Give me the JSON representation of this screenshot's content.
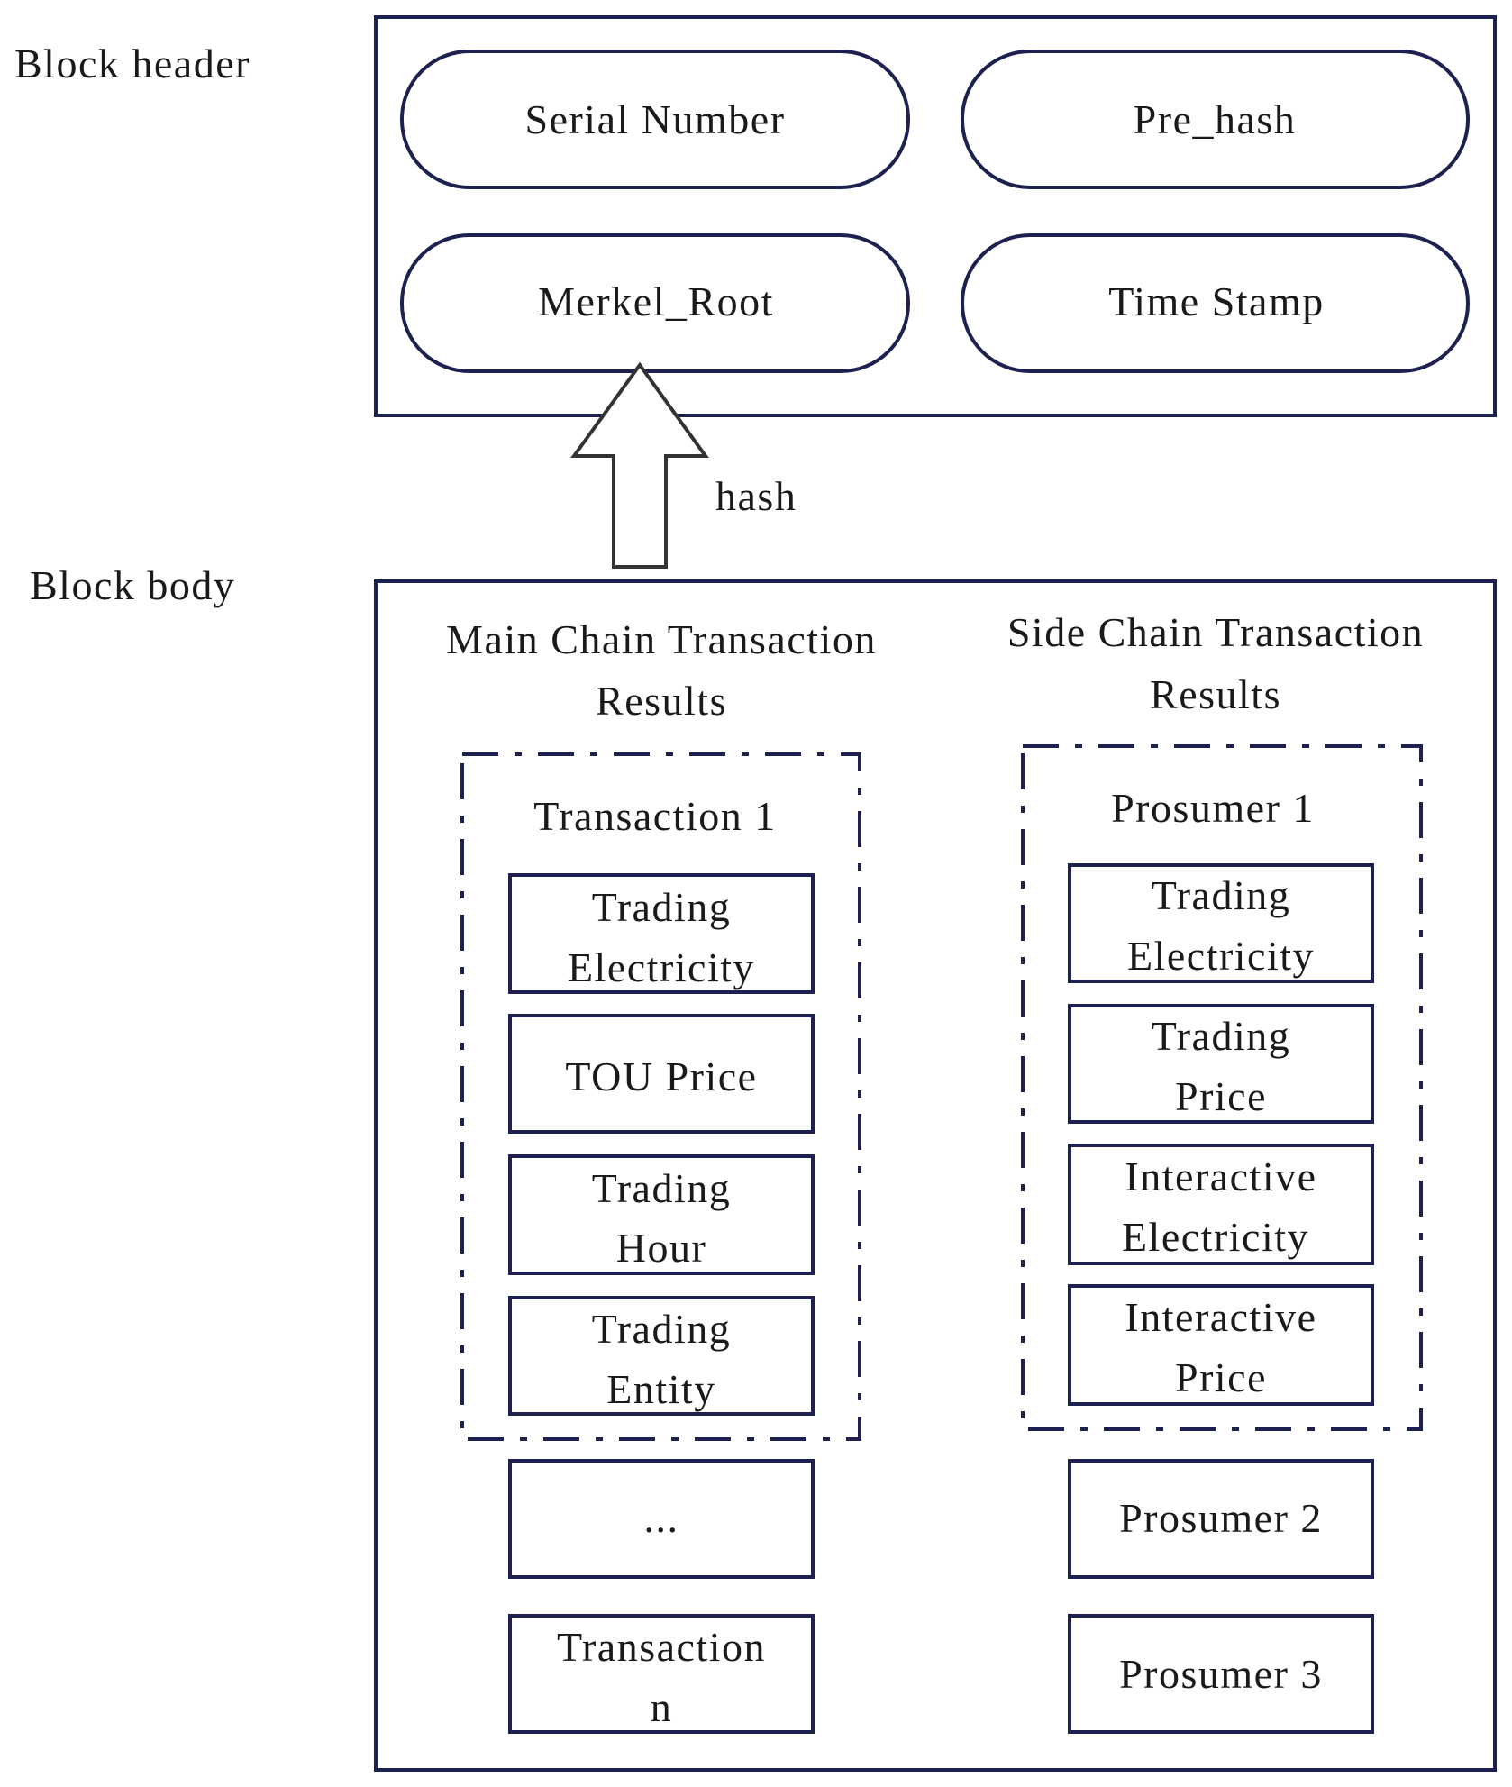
{
  "labels": {
    "block_header": "Block header",
    "block_body": "Block body",
    "hash": "hash"
  },
  "header_fields": {
    "serial_number": "Serial Number",
    "pre_hash": "Pre_hash",
    "merkel_root": "Merkel_Root",
    "time_stamp": "Time Stamp"
  },
  "main_chain": {
    "title_line1": "Main Chain Transaction",
    "title_line2": "Results",
    "group_title": "Transaction 1",
    "fields": [
      {
        "line1": "Trading",
        "line2": "Electricity"
      },
      {
        "line1": "TOU Price"
      },
      {
        "line1": "Trading",
        "line2": "Hour"
      },
      {
        "line1": "Trading",
        "line2": "Entity"
      }
    ],
    "ellipsis": "...",
    "last": {
      "line1": "Transaction",
      "line2": "n"
    }
  },
  "side_chain": {
    "title_line1": "Side Chain Transaction",
    "title_line2": "Results",
    "group_title": "Prosumer 1",
    "fields": [
      {
        "line1": "Trading",
        "line2": "Electricity"
      },
      {
        "line1": "Trading",
        "line2": "Price"
      },
      {
        "line1": "Interactive",
        "line2": "Electricity"
      },
      {
        "line1": "Interactive",
        "line2": "Price"
      }
    ],
    "others": [
      "Prosumer 2",
      "Prosumer 3"
    ]
  },
  "colors": {
    "line": "#1c2150",
    "arrow": "#333333",
    "text": "#1a1a1a"
  }
}
